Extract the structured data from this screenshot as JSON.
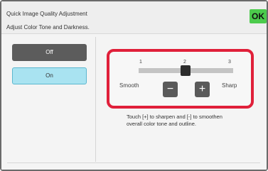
{
  "header": {
    "title_line1": "Quick Image Quality Adjustment",
    "title_line2": "Adjust Color Tone and Darkness.",
    "ok_label": "OK"
  },
  "toggle": {
    "off_label": "Off",
    "on_label": "On",
    "selected": "On"
  },
  "slider": {
    "ticks": [
      "1",
      "2",
      "3"
    ],
    "current_value": 2,
    "min": 1,
    "max": 3,
    "left_label": "Smooth",
    "right_label": "Sharp",
    "minus_label": "−",
    "plus_label": "+"
  },
  "hint": {
    "line1": "Touch [+] to sharpen and [-] to smoothen",
    "line2": "overall color tone and outline."
  },
  "colors": {
    "ok_button": "#4ccb4c",
    "on_button": "#a9e3f1",
    "highlight_border": "#e0203a"
  }
}
